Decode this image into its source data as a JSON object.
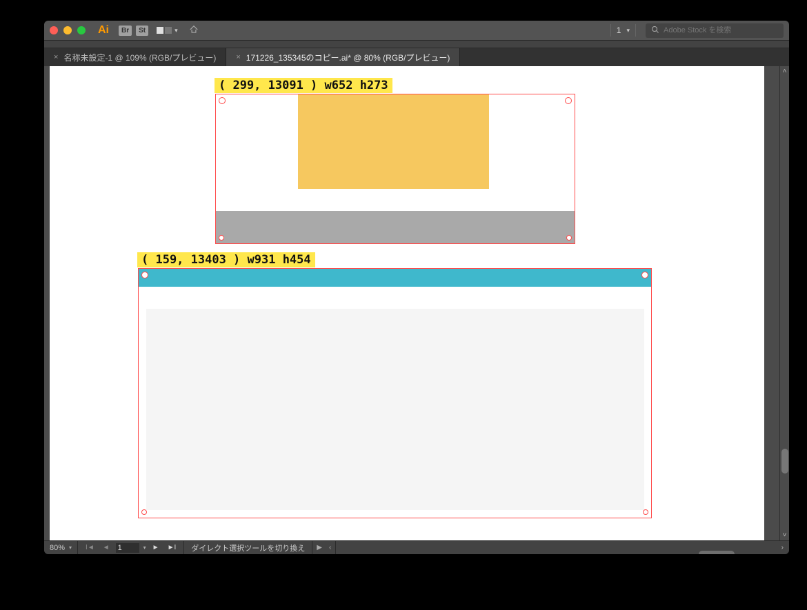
{
  "titlebar": {
    "app_logo": "Ai",
    "badge_br": "Br",
    "badge_st": "St",
    "layout_label": "1",
    "search_placeholder": "Adobe Stock を検索"
  },
  "tabs": [
    {
      "close": "×",
      "label": "名称未設定-1 @ 109% (RGB/プレビュー)"
    },
    {
      "close": "×",
      "label": "171226_135345のコピー.ai* @ 80% (RGB/プレビュー)"
    }
  ],
  "canvas": {
    "anno1": "( 299, 13091 )  w652  h273",
    "anno2": "( 159, 13403 )  w931  h454"
  },
  "statusbar": {
    "zoom": "80%",
    "artboard_nav": "1",
    "tool_hint": "ダイレクト選択ツールを切り換え"
  }
}
